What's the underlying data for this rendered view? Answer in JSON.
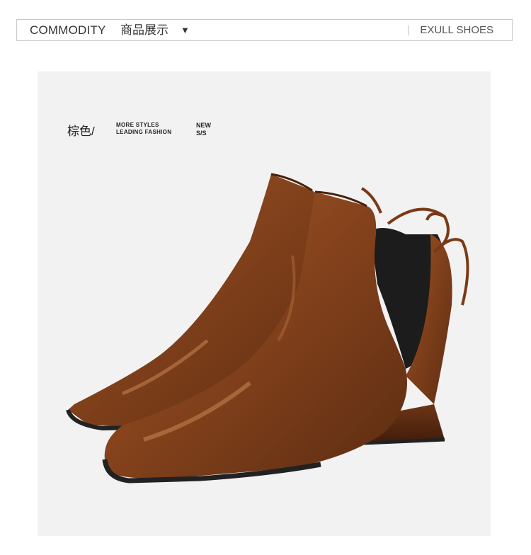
{
  "header": {
    "left_label": "COMMODITY",
    "cn_label": "商品展示",
    "arrow": "▼",
    "brand": "EXULL SHOES"
  },
  "product": {
    "color_label": "棕色/",
    "styles_line1": "MORE STYLES",
    "styles_line2": "LEADING FASHION",
    "new_line1": "NEW",
    "new_line2": "S/S",
    "image": "brown-chelsea-ankle-boots-with-bow",
    "colors": {
      "leather": "#8a4a22",
      "leather_dark": "#5a2e14",
      "elastic": "#1a1a1a",
      "panel_bg": "#f2f2f3"
    }
  }
}
